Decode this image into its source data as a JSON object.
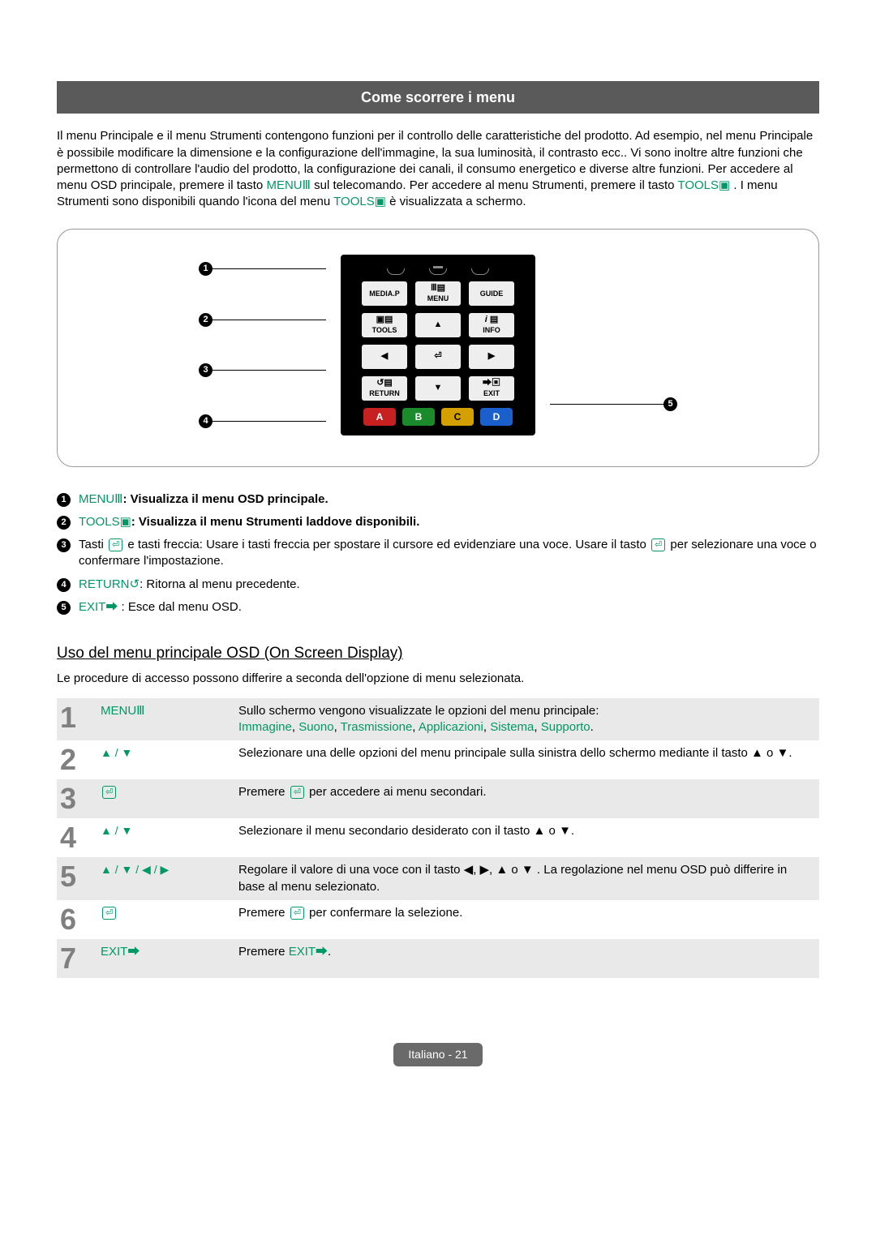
{
  "title": "Come scorrere i menu",
  "intro": {
    "p1a": "Il menu Principale e il menu Strumenti contengono funzioni per il controllo delle caratteristiche del prodotto. Ad esempio, nel menu Principale è possibile modificare la dimensione e la configurazione dell'immagine, la sua luminosità, il contrasto ecc.. Vi sono inoltre altre funzioni che permettono di controllare l'audio del prodotto, la configurazione dei canali, il consumo energetico e diverse altre funzioni. Per accedere al menu OSD principale, premere il tasto ",
    "menu_word": "MENU",
    "p1b": " sul telecomando. Per accedere al menu Strumenti, premere il tasto ",
    "tools_word": "TOOLS",
    "p1c": ". I menu Strumenti sono disponibili quando l'icona del menu ",
    "tools_word2": "TOOLS",
    "p1d": " è visualizzata a schermo."
  },
  "remote": {
    "mediap": "MEDIA.P",
    "menu": "MENU",
    "guide": "GUIDE",
    "tools": "TOOLS",
    "info": "INFO",
    "return": "RETURN",
    "exit": "EXIT",
    "colorA": "A",
    "colorB": "B",
    "colorC": "C",
    "colorD": "D",
    "n1": "1",
    "n2": "2",
    "n3": "3",
    "n4": "4",
    "n5": "5"
  },
  "legend": {
    "l1": {
      "pre": "MENU",
      "rest": ": Visualizza il menu OSD principale."
    },
    "l2": {
      "pre": "TOOLS",
      "rest": ": Visualizza il menu Strumenti laddove disponibili."
    },
    "l3": {
      "a": "Tasti ",
      "b": " e tasti freccia: Usare i tasti freccia per spostare il cursore ed evidenziare una voce. Usare il tasto ",
      "c": " per selezionare una voce o confermare l'impostazione."
    },
    "l4": {
      "pre": "RETURN",
      "rest": ": Ritorna al menu precedente."
    },
    "l5": {
      "pre": "EXIT",
      "rest": " : Esce dal menu OSD."
    }
  },
  "osd": {
    "heading": "Uso del menu principale OSD (On Screen Display)",
    "sub": "Le procedure di accesso possono differire a seconda dell'opzione di menu selezionata.",
    "steps": [
      {
        "num": "1",
        "key": "MENU",
        "key_icon": "m",
        "desc_a": "Sullo schermo vengono visualizzate le opzioni del menu principale:",
        "menu_list": [
          "Immagine",
          "Suono",
          "Trasmissione",
          "Applicazioni",
          "Sistema",
          "Supporto"
        ]
      },
      {
        "num": "2",
        "key_arrows": "▲ / ▼",
        "desc": "Selezionare una delle opzioni del menu principale sulla sinistra dello schermo mediante il tasto ▲ o ▼."
      },
      {
        "num": "3",
        "key_icon": "enter",
        "desc_a": "Premere ",
        "desc_b": " per accedere ai menu secondari."
      },
      {
        "num": "4",
        "key_arrows": "▲ / ▼",
        "desc": "Selezionare il menu secondario desiderato con il tasto ▲ o ▼."
      },
      {
        "num": "5",
        "key_arrows": "▲ / ▼ / ◀ / ▶",
        "desc": "Regolare il valore di una voce con il tasto  ◀, ▶, ▲ o ▼ . La regolazione nel menu OSD può differire in base al menu selezionato."
      },
      {
        "num": "6",
        "key_icon": "enter",
        "desc_a": "Premere ",
        "desc_b": " per confermare la selezione."
      },
      {
        "num": "7",
        "key": "EXIT",
        "key_icon": "exit",
        "desc_a": "Premere ",
        "desc_link": "EXIT",
        "desc_b": "."
      }
    ]
  },
  "footer": "Italiano - 21"
}
